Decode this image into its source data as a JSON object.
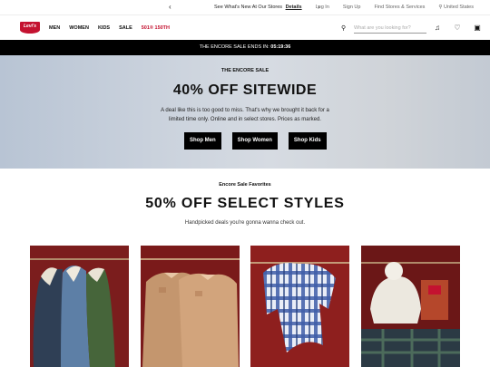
{
  "utility_bar": {
    "promo_text": "See What's New At Our Stores",
    "promo_link": "Details",
    "links": [
      "Log In",
      "Sign Up",
      "Find Stores & Services",
      "United States"
    ]
  },
  "nav": {
    "logo_text": "Levi's",
    "menu": [
      "MEN",
      "WOMEN",
      "KIDS",
      "SALE",
      "501® 150TH"
    ],
    "search_placeholder": "What are you looking for?"
  },
  "countdown": {
    "label": "THE ENCORE SALE ENDS IN:",
    "time": "05:19:36"
  },
  "hero": {
    "eyebrow": "THE ENCORE SALE",
    "headline": "40% OFF SITEWIDE",
    "body": "A deal like this is too good to miss. That's why we brought it back for a limited time only. Online and in select stores. Prices as marked.",
    "buttons": [
      "Shop Men",
      "Shop Women",
      "Shop Kids"
    ]
  },
  "section": {
    "eyebrow": "Encore Sale Favorites",
    "title": "50% OFF SELECT STYLES",
    "subtitle": "Handpicked deals you're gonna wanna check out."
  },
  "colors": {
    "brand_red": "#c41230",
    "countdown_bg": "#000000"
  }
}
